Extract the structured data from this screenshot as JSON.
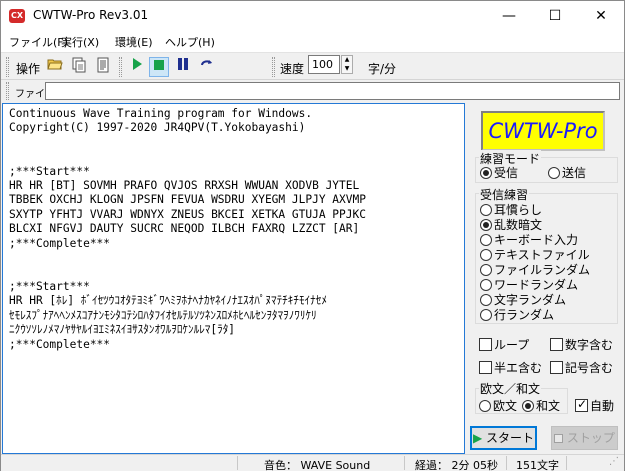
{
  "window": {
    "title": "CWTW-Pro Rev3.01",
    "icon_text": "CX",
    "controls": {
      "minimize": "—",
      "maximize": "☐",
      "close": "✕"
    }
  },
  "menu": [
    "ファイル(F)",
    "実行(X)",
    "環境(E)",
    "ヘルプ(H)"
  ],
  "toolbar": {
    "operation_label": "操作",
    "speed_label": "速度",
    "speed_value": "100",
    "speed_unit": "字/分",
    "icons": [
      "open-folder-icon",
      "copy-icon",
      "document-icon",
      "play-icon",
      "stop-icon",
      "pause-icon",
      "repeat-icon"
    ]
  },
  "file_bar": {
    "label": "ファイル",
    "value": ""
  },
  "text_content": "Continuous Wave Training program for Windows.\nCopyright(C) 1997-2020 JR4QPV(T.Yokobayashi)\n\n\n;***Start***\nHR HR [BT] SOVMH PRAFO QVJOS RRXSH WWUAN XODVB JYTEL\nTBBEK OXCHJ KLOGN JPSFN FEVUA WSDRU XYEGM JLPJY AXVMP\nSXYTP YFHTJ VVARJ WDNYX ZNEUS BKCEI XETKA GTUJA PPJKC\nBLCXI NFGVJ DAUTY SUCRC NEQOD ILBCH FAXRQ LZZCT [AR]\n;***Complete***\n\n\n;***Start***\nHR HR [ﾎﾚ] ﾎﾞｲｾﾂｳｺｵﾀﾃﾖﾐｷﾞﾜﾍﾐｦﾎﾅﾍﾅｶﾔﾈｲﾉﾅｴｽｵﾊﾟﾇﾏﾃﾁｷﾁﾓｲﾅｾﾒ\nｾﾓﾚｽﾌﾟﾅｱﾍﾍﾝﾒｽｺｱﾅﾝﾓｼﾀｺﾃｼﾛﾊﾀﾌｲｵｾﾙﾃﾙｿﾂﾈﾝｽﾛﾒﾎﾋﾍﾙｾﾝｦﾀﾏｦﾉﾜﾘｹﾘ\nﾆｸｳｿｿﾚﾉﾒﾏﾉﾔｻﾔﾙｲﾖｴﾐﾈｽｲﾖｻｽﾀﾝｵﾜﾙｦﾛｹﾝﾙﾚﾏ[ﾗﾀ]\n;***Complete***",
  "logo": "CWTW-Pro",
  "practice_mode": {
    "title": "練習モード",
    "options": [
      "受信",
      "送信"
    ],
    "selected": 0
  },
  "reception": {
    "title": "受信練習",
    "options": [
      "耳慣らし",
      "乱数暗文",
      "キーボード入力",
      "テキストファイル",
      "ファイルランダム",
      "ワードランダム",
      "文字ランダム",
      "行ランダム"
    ],
    "selected": 1
  },
  "checkboxes": [
    {
      "label": "ループ",
      "checked": false
    },
    {
      "label": "数字含む",
      "checked": false
    },
    {
      "label": "半エ含む",
      "checked": false
    },
    {
      "label": "記号含む",
      "checked": false
    }
  ],
  "language": {
    "title": "欧文／和文",
    "options": [
      "欧文",
      "和文"
    ],
    "selected": 1,
    "auto_label": "自動",
    "auto_checked": true
  },
  "buttons": {
    "start": "スタート",
    "stop": "ストップ"
  },
  "status": {
    "sound": "音色： WAVE Sound",
    "elapsed": "経過： 2分 05秒",
    "chars": "151文字"
  }
}
